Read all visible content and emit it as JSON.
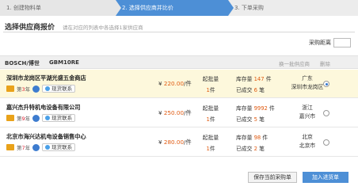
{
  "steps": [
    "1. 创建物料单",
    "2. 选择供应商并比价",
    "3. 下单采购"
  ],
  "section": {
    "title": "选择供应商报价",
    "hint": "请在对应的列表中各选择1家供应商"
  },
  "distance_label": "采购距离",
  "product": {
    "brand": "BOSCH/博世",
    "model": "GBM10RE",
    "next_product": "换一批供应商",
    "delete": "删除"
  },
  "suppliers": [
    {
      "name": "深圳市龙岗区平湖光盛五金商店",
      "grade_prefix": "第",
      "grade_num": "3",
      "grade_suffix": "年",
      "contact": "现货联系",
      "price_prefix": "¥",
      "price": "220.00",
      "price_unit": "/件",
      "moq_label": "起批量",
      "moq": "1",
      "moq_unit": "件",
      "stock_label": "库存量",
      "stock": "147",
      "stock_unit": "件",
      "sold_label": "已成交",
      "sold": "6",
      "sold_unit": "笔",
      "province": "广东",
      "city": "深圳市龙岗区",
      "selected": true
    },
    {
      "name": "嘉兴杰升特机电设备有限公司",
      "grade_prefix": "第",
      "grade_num": "9",
      "grade_suffix": "年",
      "contact": "现货联系",
      "price_prefix": "¥",
      "price": "250.00",
      "price_unit": "/件",
      "moq_label": "起批量",
      "moq": "1",
      "moq_unit": "件",
      "stock_label": "库存量",
      "stock": "9992",
      "stock_unit": "件",
      "sold_label": "已成交",
      "sold": "5",
      "sold_unit": "笔",
      "province": "浙江",
      "city": "嘉兴市",
      "selected": false
    },
    {
      "name": "北京市海兴达机电设备销售中心",
      "grade_prefix": "第",
      "grade_num": "7",
      "grade_suffix": "年",
      "contact": "现货联系",
      "price_prefix": "¥",
      "price": "280.00",
      "price_unit": "/件",
      "moq_label": "起批量",
      "moq": "1",
      "moq_unit": "件",
      "stock_label": "库存量",
      "stock": "98",
      "stock_unit": "件",
      "sold_label": "已成交",
      "sold": "2",
      "sold_unit": "笔",
      "province": "北京",
      "city": "北京市",
      "selected": false
    }
  ],
  "buttons": {
    "save": "保存当前采购单",
    "add": "加入进货单"
  },
  "colors": {
    "accent": "#4d8fd6",
    "highlight": "#e05a10",
    "selected_row": "#fdf8dc"
  }
}
